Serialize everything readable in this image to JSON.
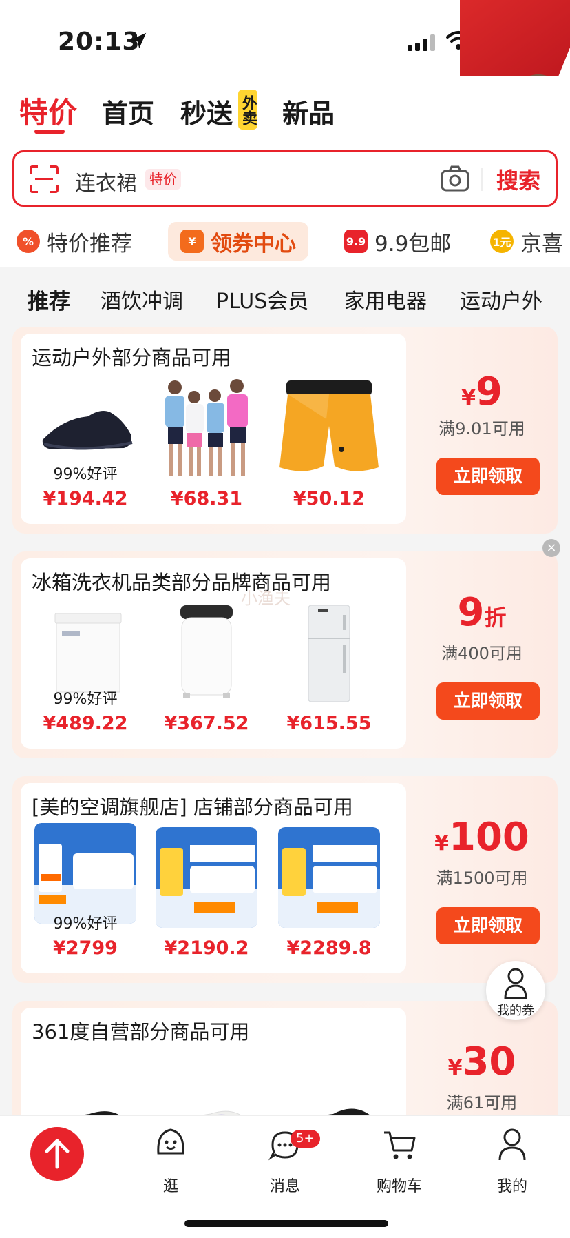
{
  "status": {
    "time": "20:13"
  },
  "top_tabs": [
    {
      "label": "特价"
    },
    {
      "label": "首页"
    },
    {
      "label": "秒送"
    },
    {
      "label": "新品"
    }
  ],
  "waimai_tag": "外卖",
  "search": {
    "value": "连衣裙",
    "tag": "特价",
    "button": "搜索"
  },
  "promo": [
    {
      "label": "特价推荐",
      "color": "#f0502a"
    },
    {
      "label": "领券中心",
      "color": "#f36b1c"
    },
    {
      "label": "9.9包邮",
      "icon_text": "9.9",
      "color": "#e8232b"
    },
    {
      "label": "京喜",
      "icon_text": "1元",
      "color": "#f5b400"
    }
  ],
  "categories": [
    "推荐",
    "酒饮冲调",
    "PLUS会员",
    "家用电器",
    "运动户外"
  ],
  "cards": [
    {
      "title": "运动户外部分商品可用",
      "amount": {
        "sym": "¥",
        "num": "9",
        "unit": ""
      },
      "condition": "满9.01可用",
      "button": "立即领取",
      "products": [
        {
          "note": "99%好评",
          "price": "¥194.42",
          "image": "black-sneaker"
        },
        {
          "note": "",
          "price": "¥68.31",
          "image": "sport-models"
        },
        {
          "note": "",
          "price": "¥50.12",
          "image": "orange-shorts"
        }
      ]
    },
    {
      "title": "冰箱洗衣机品类部分品牌商品可用",
      "amount": {
        "sym": "",
        "num": "9",
        "unit": "折"
      },
      "condition": "满400可用",
      "button": "立即领取",
      "products": [
        {
          "note": "99%好评",
          "price": "¥489.22",
          "image": "chest-freezer"
        },
        {
          "note": "",
          "price": "¥367.52",
          "image": "mini-washer"
        },
        {
          "note": "",
          "price": "¥615.55",
          "image": "fridge"
        }
      ]
    },
    {
      "title": "[美的空调旗舰店] 店铺部分商品可用",
      "amount": {
        "sym": "¥",
        "num": "100",
        "unit": ""
      },
      "condition": "满1500可用",
      "button": "立即领取",
      "products": [
        {
          "note": "99%好评",
          "price": "¥2799",
          "image": "aircon-ultra"
        },
        {
          "note": "",
          "price": "¥2190.2",
          "image": "aircon-40"
        },
        {
          "note": "",
          "price": "¥2289.8",
          "image": "aircon-37"
        }
      ]
    },
    {
      "title": "361度自营部分商品可用",
      "amount": {
        "sym": "¥",
        "num": "30",
        "unit": ""
      },
      "condition": "满61可用",
      "button": "",
      "products": [
        {
          "note": "",
          "price": "",
          "image": "black-shoe"
        },
        {
          "note": "",
          "price": "",
          "image": "white-shoe"
        },
        {
          "note": "",
          "price": "",
          "image": "black-shoe-2"
        }
      ]
    }
  ],
  "watermark": "小渔夫",
  "my_coupon": "我的券",
  "bottom_nav": [
    {
      "label": "逛"
    },
    {
      "label": "消息",
      "badge": "5+"
    },
    {
      "label": "购物车"
    },
    {
      "label": "我的"
    }
  ],
  "colors": {
    "accent": "#e8232b",
    "claim": "#f4491c"
  }
}
